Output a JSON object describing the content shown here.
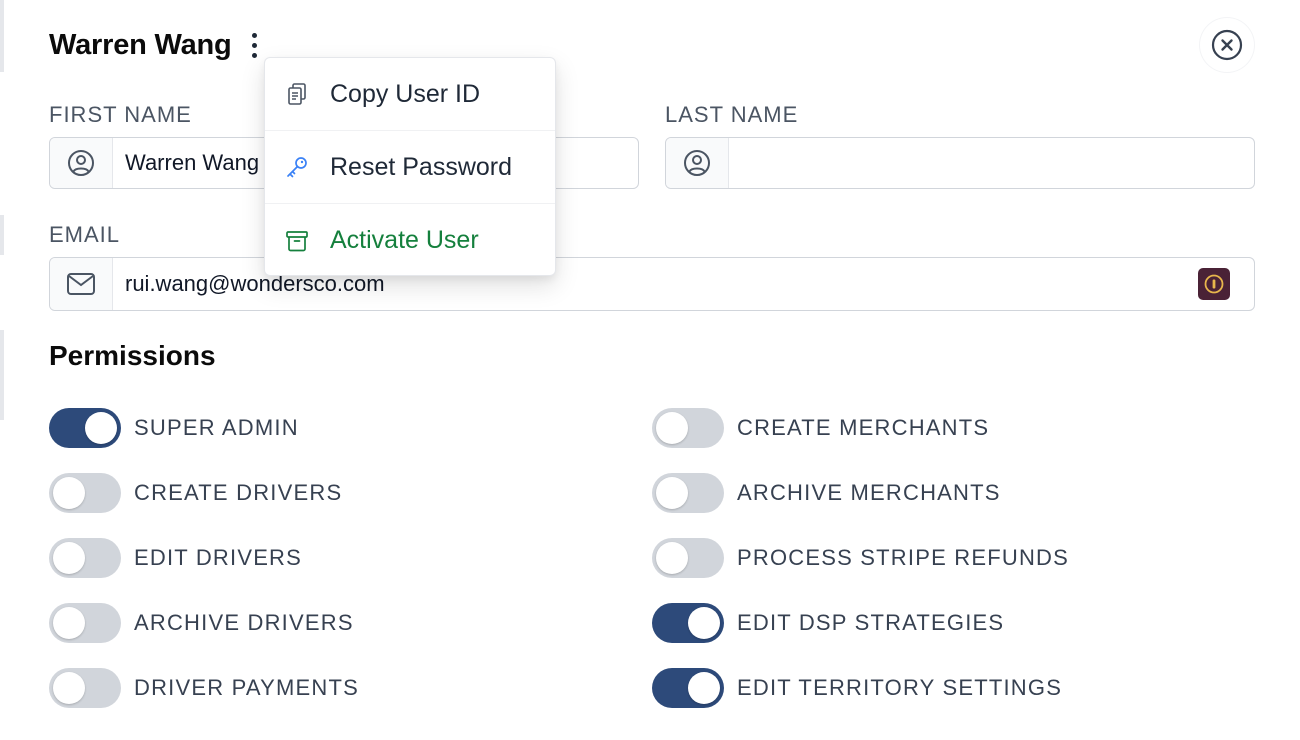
{
  "header": {
    "title": "Warren Wang"
  },
  "form": {
    "first_name": {
      "label": "FIRST NAME",
      "value": "Warren Wang"
    },
    "last_name": {
      "label": "LAST NAME",
      "value": ""
    },
    "email": {
      "label": "EMAIL",
      "value": "rui.wang@wondersco.com"
    }
  },
  "permissions": {
    "title": "Permissions",
    "left": [
      {
        "label": "SUPER ADMIN",
        "enabled": true
      },
      {
        "label": "CREATE DRIVERS",
        "enabled": false
      },
      {
        "label": "EDIT DRIVERS",
        "enabled": false
      },
      {
        "label": "ARCHIVE DRIVERS",
        "enabled": false
      },
      {
        "label": "DRIVER PAYMENTS",
        "enabled": false
      }
    ],
    "right": [
      {
        "label": "CREATE MERCHANTS",
        "enabled": false
      },
      {
        "label": "ARCHIVE MERCHANTS",
        "enabled": false
      },
      {
        "label": "PROCESS STRIPE REFUNDS",
        "enabled": false
      },
      {
        "label": "EDIT DSP STRATEGIES",
        "enabled": true
      },
      {
        "label": "EDIT TERRITORY SETTINGS",
        "enabled": true
      }
    ]
  },
  "menu": {
    "items": [
      {
        "label": "Copy User ID",
        "icon": "copy-icon"
      },
      {
        "label": "Reset Password",
        "icon": "key-icon"
      },
      {
        "label": "Activate User",
        "icon": "archive-box-icon"
      }
    ]
  },
  "colors": {
    "toggle_on": "#2d4a7a",
    "toggle_off": "#d1d5db",
    "activate_green": "#15803d",
    "password_manager": "#4a2236"
  }
}
